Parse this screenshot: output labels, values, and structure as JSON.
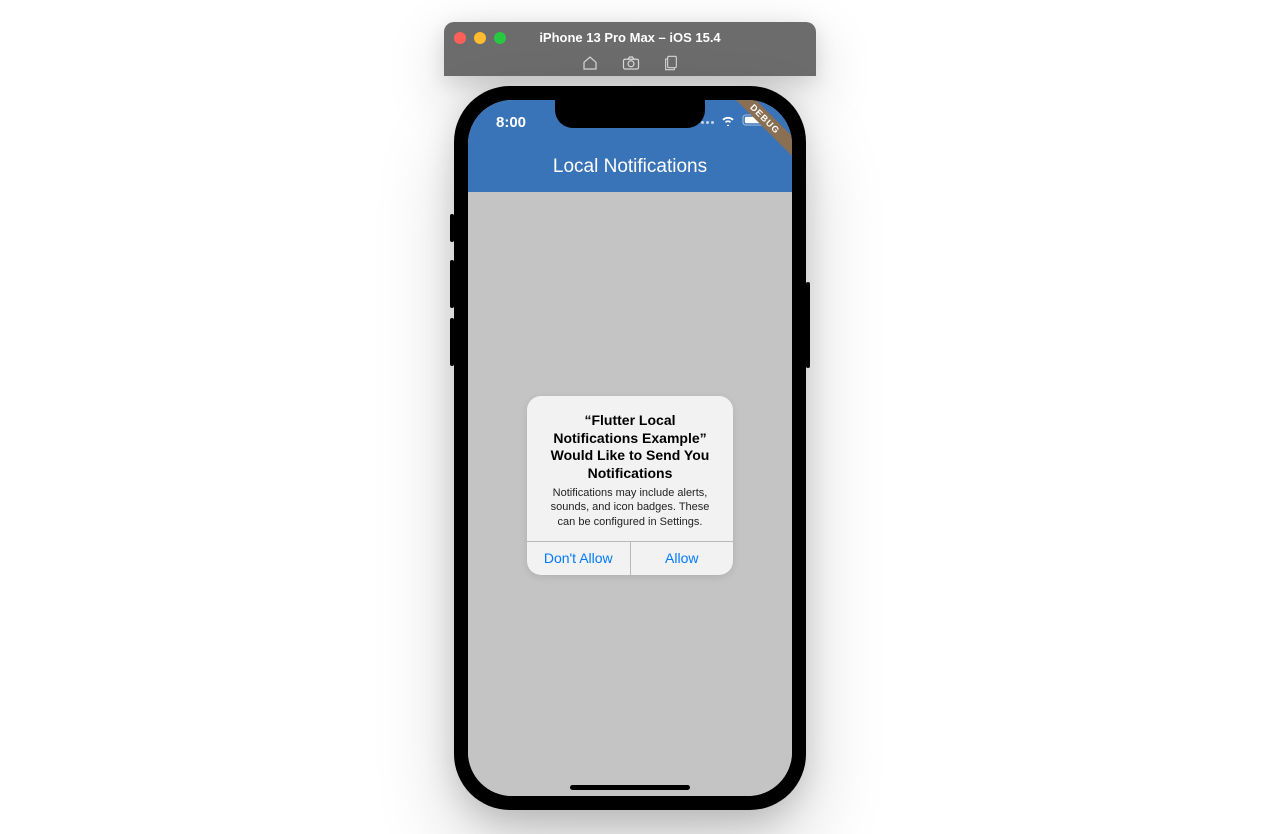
{
  "simulator": {
    "title": "iPhone 13 Pro Max – iOS 15.4",
    "icons": {
      "home": "home-icon",
      "screenshot": "camera-icon",
      "rotate": "copy-icon"
    }
  },
  "statusbar": {
    "time": "8:00"
  },
  "app": {
    "title": "Local Notifications",
    "debug_label": "DEBUG"
  },
  "alert": {
    "title": "“Flutter Local Notifications Example” Would Like to Send You Notifications",
    "message": "Notifications may include alerts, sounds, and icon badges. These can be configured in Settings.",
    "dont_allow": "Don't Allow",
    "allow": "Allow"
  },
  "colors": {
    "appbar": "#3973b8",
    "ios_link": "#007aff"
  }
}
